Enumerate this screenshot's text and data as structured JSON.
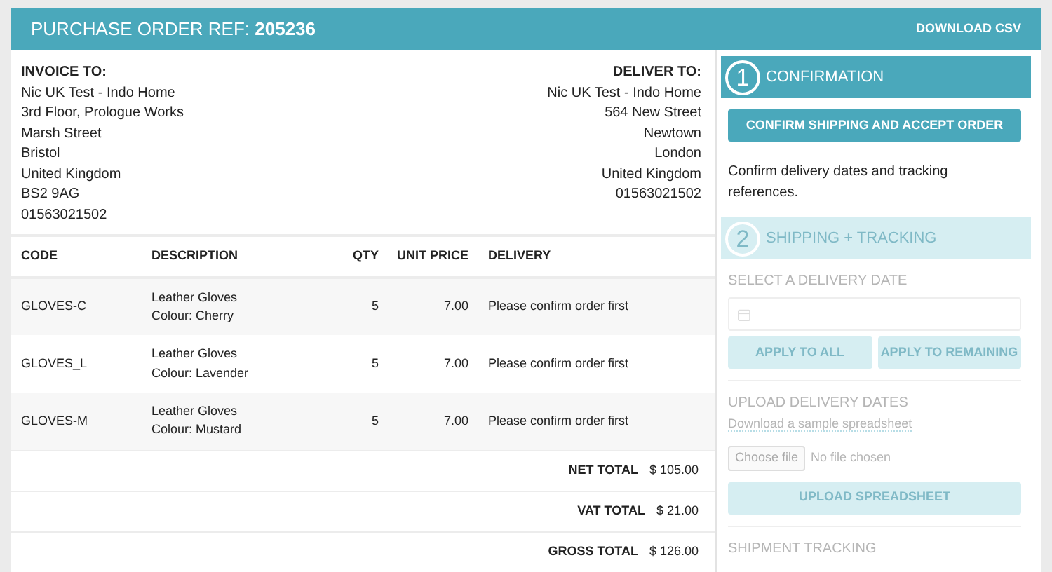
{
  "header": {
    "title": "PURCHASE ORDER REF:",
    "ref": "205236",
    "download": "DOWNLOAD CSV"
  },
  "invoice": {
    "heading": "INVOICE TO:",
    "lines": [
      "Nic UK Test - Indo Home",
      "3rd Floor, Prologue Works",
      "Marsh Street",
      "Bristol",
      "United Kingdom",
      "BS2 9AG",
      "01563021502"
    ]
  },
  "delivery": {
    "heading": "DELIVER TO:",
    "lines": [
      "Nic UK Test - Indo Home",
      "564 New Street",
      "Newtown",
      "London",
      "United Kingdom",
      "01563021502"
    ]
  },
  "table": {
    "columns": [
      "CODE",
      "DESCRIPTION",
      "QTY",
      "UNIT PRICE",
      "DELIVERY"
    ],
    "rows": [
      {
        "code": "GLOVES-C",
        "description": [
          "Leather Gloves",
          "Colour: Cherry"
        ],
        "qty": "5",
        "unit_price": "7.00",
        "delivery": "Please confirm order first"
      },
      {
        "code": "GLOVES_L",
        "description": [
          "Leather Gloves",
          "Colour: Lavender"
        ],
        "qty": "5",
        "unit_price": "7.00",
        "delivery": "Please confirm order first"
      },
      {
        "code": "GLOVES-M",
        "description": [
          "Leather Gloves",
          "Colour: Mustard"
        ],
        "qty": "5",
        "unit_price": "7.00",
        "delivery": "Please confirm order first"
      }
    ],
    "totals": [
      {
        "label": "NET TOTAL",
        "value": "$ 105.00"
      },
      {
        "label": "VAT TOTAL",
        "value": "$ 21.00"
      },
      {
        "label": "GROSS TOTAL",
        "value": "$ 126.00"
      }
    ]
  },
  "steps": [
    {
      "number": "1",
      "title": "CONFIRMATION",
      "disabled": false,
      "button": "CONFIRM SHIPPING AND ACCEPT ORDER",
      "note": "Confirm delivery dates and tracking references."
    },
    {
      "number": "2",
      "title": "SHIPPING + TRACKING",
      "disabled": true,
      "date_label": "SELECT A DELIVERY DATE",
      "apply_buttons": [
        "APPLY TO ALL",
        "APPLY TO REMAINING"
      ],
      "upload_label": "UPLOAD DELIVERY DATES",
      "sample_link": "Download a sample spreadsheet",
      "file_button": "Choose file",
      "file_status": "No file chosen",
      "upload_button": "UPLOAD SPREADSHEET",
      "tracking_label": "SHIPMENT TRACKING"
    }
  ]
}
